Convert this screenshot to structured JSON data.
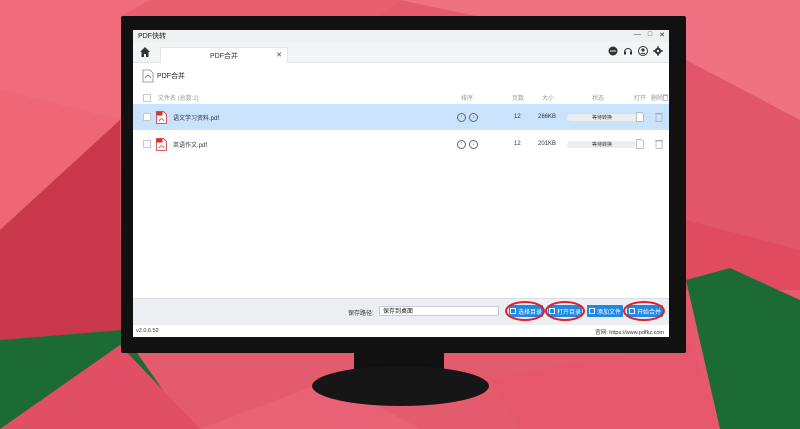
{
  "window": {
    "title": "PDF快转",
    "controls": [
      "—",
      "□",
      "✕"
    ]
  },
  "tabs": [
    {
      "label": "PDF合并",
      "close": "✕"
    }
  ],
  "subheader": {
    "label": "PDF合并"
  },
  "table": {
    "headers": {
      "name": "文件名 (总数:2)",
      "sort": "排序",
      "pages": "页数",
      "size": "大小",
      "status": "状态",
      "open": "打开",
      "delete": "删除"
    },
    "rows": [
      {
        "name": "语文学习资料.pdf",
        "pages": "12",
        "size": "266KB",
        "status": "等待转换",
        "selected": true
      },
      {
        "name": "英语作文.pdf",
        "pages": "12",
        "size": "201KB",
        "status": "等待转换",
        "selected": false
      }
    ]
  },
  "footer": {
    "save_path_label": "保存路径:",
    "save_path_value": "保存到桌面",
    "buttons": {
      "choose_dir": "选择目录",
      "open_dir": "打开目录",
      "add_file": "添加文件",
      "start_merge": "开始合并"
    }
  },
  "statusbar": {
    "version": "v2.0.6.52",
    "site": "官网: https://www.pdfkz.com"
  },
  "colors": {
    "accent": "#1e88e5",
    "selection": "#c8e3fb",
    "highlight_ring": "#e0212d",
    "background": "#e35a6c"
  },
  "icons": [
    "home-icon",
    "chat-icon",
    "headset-icon",
    "user-icon",
    "gear-icon",
    "pdf-merge-icon",
    "pdf-file-icon",
    "sort-up-icon",
    "sort-down-icon",
    "open-file-icon",
    "trash-icon"
  ]
}
